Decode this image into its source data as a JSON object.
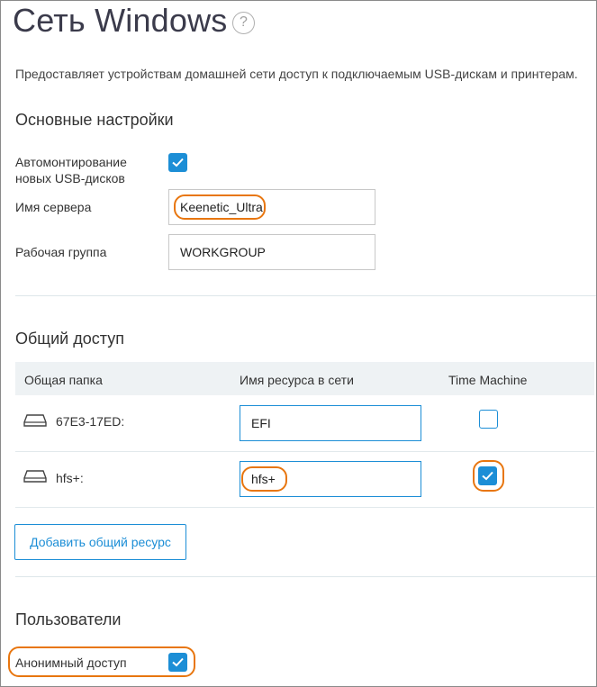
{
  "page": {
    "title": "Сеть Windows",
    "help_icon": "?",
    "description": "Предоставляет устройствам домашней сети доступ к подключаемым USB-дискам и принтерам."
  },
  "basic": {
    "title": "Основные настройки",
    "automount_label_line1": "Автомонтирование",
    "automount_label_line2": "новых USB-дисков",
    "automount_checked": true,
    "server_name_label": "Имя сервера",
    "server_name_value": "Keenetic_Ultra",
    "workgroup_label": "Рабочая группа",
    "workgroup_value": "WORKGROUP"
  },
  "sharing": {
    "title": "Общий доступ",
    "columns": [
      "Общая папка",
      "Имя ресурса в сети",
      "Time Machine"
    ],
    "rows": [
      {
        "folder": "67E3-17ED:",
        "share_name": "EFI",
        "time_machine": false,
        "icon": "drive-icon"
      },
      {
        "folder": "hfs+:",
        "share_name": "hfs+",
        "time_machine": true,
        "icon": "drive-icon"
      }
    ],
    "add_button": "Добавить общий ресурс"
  },
  "users": {
    "title": "Пользователи",
    "anonymous_label": "Анонимный доступ",
    "anonymous_checked": true
  },
  "colors": {
    "accent": "#1c8ed6",
    "highlight": "#e8760f",
    "header_bg": "#eef2f4",
    "title_text": "#3b3b4b"
  }
}
